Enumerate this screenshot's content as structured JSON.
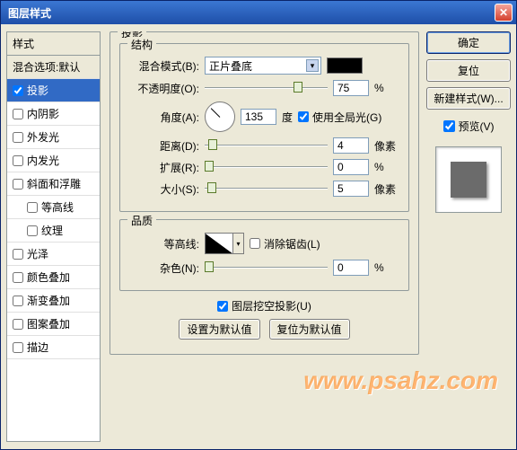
{
  "window": {
    "title": "图层样式"
  },
  "sidebar": {
    "header": "样式",
    "blend_opts": "混合选项:默认",
    "items": [
      {
        "label": "投影",
        "checked": true,
        "active": true
      },
      {
        "label": "内阴影",
        "checked": false
      },
      {
        "label": "外发光",
        "checked": false
      },
      {
        "label": "内发光",
        "checked": false
      },
      {
        "label": "斜面和浮雕",
        "checked": false
      },
      {
        "label": "等高线",
        "checked": false,
        "indent": true
      },
      {
        "label": "纹理",
        "checked": false,
        "indent": true
      },
      {
        "label": "光泽",
        "checked": false
      },
      {
        "label": "颜色叠加",
        "checked": false
      },
      {
        "label": "渐变叠加",
        "checked": false
      },
      {
        "label": "图案叠加",
        "checked": false
      },
      {
        "label": "描边",
        "checked": false
      }
    ]
  },
  "panel": {
    "title": "投影",
    "structure": {
      "title": "结构",
      "blend_mode_label": "混合模式(B):",
      "blend_mode_value": "正片叠底",
      "opacity_label": "不透明度(O):",
      "opacity_value": "75",
      "opacity_unit": "%",
      "angle_label": "角度(A):",
      "angle_value": "135",
      "angle_unit": "度",
      "global_light": "使用全局光(G)",
      "distance_label": "距离(D):",
      "distance_value": "4",
      "distance_unit": "像素",
      "spread_label": "扩展(R):",
      "spread_value": "0",
      "spread_unit": "%",
      "size_label": "大小(S):",
      "size_value": "5",
      "size_unit": "像素"
    },
    "quality": {
      "title": "品质",
      "contour_label": "等高线:",
      "antialias": "消除锯齿(L)",
      "noise_label": "杂色(N):",
      "noise_value": "0",
      "noise_unit": "%"
    },
    "knockout": "图层挖空投影(U)",
    "btn_default": "设置为默认值",
    "btn_reset": "复位为默认值"
  },
  "right": {
    "ok": "确定",
    "cancel": "复位",
    "new_style": "新建样式(W)...",
    "preview": "预览(V)"
  },
  "watermark": "www.psahz.com"
}
